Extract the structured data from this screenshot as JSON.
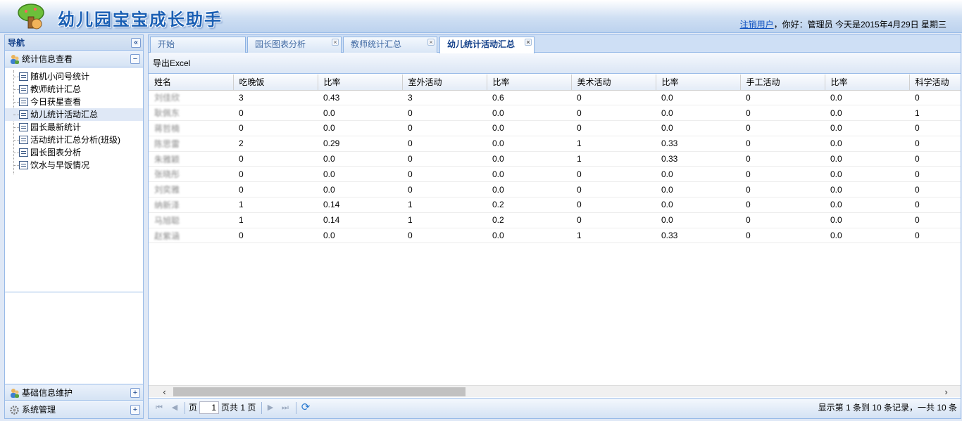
{
  "header": {
    "title": "幼儿园宝宝成长助手",
    "logout_link": "注销用户",
    "greeting": "，你好：管理员 今天是2015年4月29日 星期三"
  },
  "nav": {
    "title": "导航",
    "collapse_glyph": "«",
    "sections": [
      {
        "label": "统计信息查看",
        "tool": "−"
      },
      {
        "label": "基础信息维护",
        "tool": "+"
      },
      {
        "label": "系统管理",
        "tool": "+"
      }
    ],
    "items": [
      {
        "label": "随机小问号统计"
      },
      {
        "label": "教师统计汇总"
      },
      {
        "label": "今日获星查看"
      },
      {
        "label": "幼儿统计活动汇总"
      },
      {
        "label": "园长最新统计"
      },
      {
        "label": "活动统计汇总分析(班级)"
      },
      {
        "label": "园长图表分析"
      },
      {
        "label": "饮水与早饭情况"
      }
    ]
  },
  "tabs": [
    {
      "label": "开始"
    },
    {
      "label": "园长图表分析"
    },
    {
      "label": "教师统计汇总"
    },
    {
      "label": "幼儿统计活动汇总"
    }
  ],
  "toolbar": {
    "export_label": "导出Excel"
  },
  "grid": {
    "columns": [
      "姓名",
      "吃晚饭",
      "比率",
      "室外活动",
      "比率",
      "美术活动",
      "比率",
      "手工活动",
      "比率",
      "科学活动"
    ],
    "rows": [
      [
        "刘佳欣",
        "3",
        "0.43",
        "3",
        "0.6",
        "0",
        "0.0",
        "0",
        "0.0",
        "0"
      ],
      [
        "耿佩东",
        "0",
        "0.0",
        "0",
        "0.0",
        "0",
        "0.0",
        "0",
        "0.0",
        "1"
      ],
      [
        "蒋哲楠",
        "0",
        "0.0",
        "0",
        "0.0",
        "0",
        "0.0",
        "0",
        "0.0",
        "0"
      ],
      [
        "陈思雷",
        "2",
        "0.29",
        "0",
        "0.0",
        "1",
        "0.33",
        "0",
        "0.0",
        "0"
      ],
      [
        "朱雅颖",
        "0",
        "0.0",
        "0",
        "0.0",
        "1",
        "0.33",
        "0",
        "0.0",
        "0"
      ],
      [
        "张晓彤",
        "0",
        "0.0",
        "0",
        "0.0",
        "0",
        "0.0",
        "0",
        "0.0",
        "0"
      ],
      [
        "刘奕雅",
        "0",
        "0.0",
        "0",
        "0.0",
        "0",
        "0.0",
        "0",
        "0.0",
        "0"
      ],
      [
        "纳新泽",
        "1",
        "0.14",
        "1",
        "0.2",
        "0",
        "0.0",
        "0",
        "0.0",
        "0"
      ],
      [
        "马旭聪",
        "1",
        "0.14",
        "1",
        "0.2",
        "0",
        "0.0",
        "0",
        "0.0",
        "0"
      ],
      [
        "赵紫涵",
        "0",
        "0.0",
        "0",
        "0.0",
        "1",
        "0.33",
        "0",
        "0.0",
        "0"
      ]
    ]
  },
  "pager": {
    "page_label": "页",
    "page_value": "1",
    "total_label": "页共 1 页",
    "display_msg": "显示第 1 条到 10 条记录，一共 10 条"
  },
  "icons": {
    "first": "⏮",
    "prev": "◀",
    "next": "▶",
    "last": "⏭",
    "refresh": "⟳",
    "scroll_left": "‹",
    "scroll_right": "›"
  }
}
